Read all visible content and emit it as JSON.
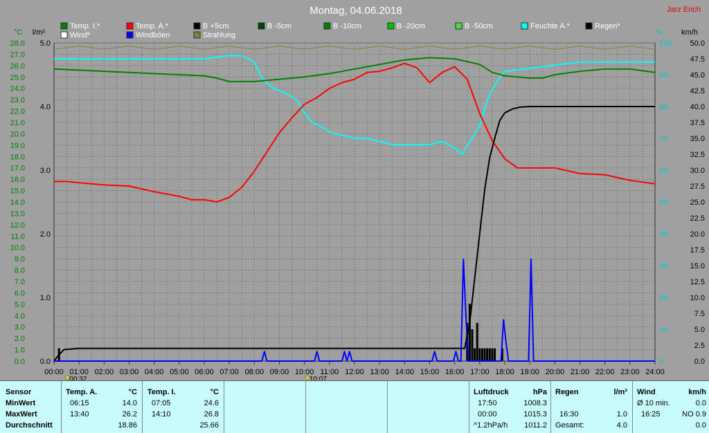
{
  "header": {
    "date": "Montag, 04.06.2018",
    "author": "Jarz Erich"
  },
  "colors": {
    "background": "#a0a0a0",
    "plot_background": "#a0a0a0",
    "grid": "#7c7c7c",
    "left_axis": "#008000",
    "right_axis": "#00c8c8",
    "temp_inside": "#008000",
    "temp_outside": "#ff0000",
    "humidity": "#00ffff",
    "rain": "#000000",
    "wind_gusts": "#0000ff",
    "radiation": "#808040",
    "panel": "#c8fcfc"
  },
  "chart_data": {
    "type": "line",
    "x_range": [
      "00:00",
      "24:00"
    ],
    "x_ticks": [
      "00:00",
      "01:00",
      "02:00",
      "03:00",
      "04:00",
      "05:00",
      "06:00",
      "07:00",
      "08:00",
      "09:00",
      "10:00",
      "11:00",
      "12:00",
      "13:00",
      "14:00",
      "15:00",
      "16:00",
      "17:00",
      "18:00",
      "19:00",
      "20:00",
      "21:00",
      "22:00",
      "23:00",
      "24:00"
    ],
    "axes": {
      "temp": {
        "label": "°C",
        "ylim": [
          0,
          28
        ],
        "step": 1
      },
      "rain": {
        "label": "l/m²",
        "ylim": [
          0,
          5
        ],
        "ticks": [
          0.0,
          1.0,
          2.0,
          3.0,
          4.0,
          5.0
        ]
      },
      "humidity": {
        "label": "%",
        "ylim": [
          0,
          100
        ],
        "step": 10
      },
      "wind": {
        "label": "km/h",
        "ylim": [
          0,
          50
        ],
        "step": 2.5
      }
    },
    "grid": true,
    "legend": [
      {
        "name": "Temp. I.*",
        "color": "#008000"
      },
      {
        "name": "Temp. A.*",
        "color": "#ff0000"
      },
      {
        "name": "B +5cm",
        "color": "#000000"
      },
      {
        "name": "B -5cm",
        "color": "#004000"
      },
      {
        "name": "B -10cm",
        "color": "#008000"
      },
      {
        "name": "B -20cm",
        "color": "#00c000"
      },
      {
        "name": "B -50cm",
        "color": "#40e040"
      },
      {
        "name": "Feuchte A.*",
        "color": "#00ffff"
      },
      {
        "name": "Regen*",
        "color": "#000000"
      },
      {
        "name": "Wind*",
        "color": "#ffffff"
      },
      {
        "name": "Windböen",
        "color": "#0000ff"
      },
      {
        "name": "Strahlung",
        "color": "#808040"
      }
    ],
    "series": [
      {
        "name": "Temp. I.*",
        "axis": "temp",
        "color": "#008000",
        "x": [
          0,
          1,
          2,
          3,
          4,
          5,
          6,
          6.5,
          7,
          7.5,
          8,
          9,
          10,
          11,
          12,
          13,
          14,
          15,
          16,
          17,
          17.5,
          18,
          19,
          19.5,
          20,
          21,
          22,
          23,
          24
        ],
        "y": [
          25.7,
          25.6,
          25.5,
          25.4,
          25.3,
          25.2,
          25.1,
          24.9,
          24.6,
          24.6,
          24.6,
          24.8,
          25.0,
          25.3,
          25.7,
          26.1,
          26.5,
          26.7,
          26.6,
          26.1,
          25.4,
          25.1,
          24.9,
          24.9,
          25.2,
          25.5,
          25.7,
          25.7,
          25.4
        ]
      },
      {
        "name": "Temp. A.*",
        "axis": "temp",
        "color": "#ff0000",
        "x": [
          0,
          0.5,
          1,
          2,
          3,
          4,
          5,
          5.5,
          6,
          6.5,
          7,
          7.5,
          8,
          8.5,
          9,
          9.5,
          10,
          10.5,
          11,
          11.5,
          12,
          12.5,
          13,
          13.5,
          14,
          14.5,
          15,
          15.5,
          16,
          16.5,
          17,
          17.5,
          18,
          18.5,
          19,
          20,
          21,
          22,
          23,
          24
        ],
        "y": [
          15.8,
          15.8,
          15.7,
          15.5,
          15.4,
          14.9,
          14.5,
          14.2,
          14.2,
          14.0,
          14.4,
          15.3,
          16.7,
          18.4,
          20.1,
          21.4,
          22.6,
          23.2,
          24.0,
          24.5,
          24.8,
          25.4,
          25.5,
          25.8,
          26.2,
          25.8,
          24.5,
          25.4,
          25.9,
          24.8,
          21.8,
          19.4,
          17.8,
          17.0,
          17.0,
          17.0,
          16.5,
          16.4,
          15.9,
          15.6
        ]
      },
      {
        "name": "Feuchte A.*",
        "axis": "humidity",
        "color": "#00ffff",
        "x": [
          0,
          1,
          2,
          3,
          4,
          5,
          6,
          7,
          7.5,
          8,
          8.3,
          8.7,
          9.3,
          9.7,
          10,
          10.3,
          10.6,
          11,
          11.5,
          12,
          12.5,
          13,
          13.5,
          14,
          14.5,
          15,
          15.5,
          16,
          16.3,
          16.6,
          17,
          17.3,
          17.7,
          18,
          19,
          20,
          21,
          22,
          23,
          24
        ],
        "y": [
          95,
          95,
          95,
          95,
          95,
          95,
          95,
          96,
          96,
          94,
          89,
          86,
          84,
          82,
          78,
          75,
          74,
          72,
          71,
          70,
          70,
          69,
          68,
          68,
          68,
          68,
          69,
          67,
          65,
          69,
          74,
          82,
          88,
          91,
          92,
          93,
          94,
          94,
          94,
          94
        ]
      },
      {
        "name": "Regen*",
        "axis": "rain",
        "color": "#000000",
        "x": [
          0,
          0.2,
          0.4,
          1,
          2,
          5,
          10,
          15,
          16.4,
          16.6,
          16.8,
          17.0,
          17.2,
          17.4,
          17.6,
          17.8,
          18.0,
          18.3,
          18.6,
          19,
          20,
          22,
          24
        ],
        "y": [
          0.0,
          0.1,
          0.18,
          0.2,
          0.2,
          0.2,
          0.2,
          0.2,
          0.2,
          0.6,
          1.3,
          2.0,
          2.7,
          3.2,
          3.5,
          3.78,
          3.9,
          3.96,
          3.99,
          4.0,
          4.0,
          4.0,
          4.0
        ]
      },
      {
        "name": "Windböen",
        "axis": "wind",
        "color": "#0000ff",
        "x": [
          0,
          8.3,
          8.4,
          8.5,
          10.4,
          10.5,
          10.6,
          11.5,
          11.6,
          11.7,
          11.8,
          11.9,
          12.0,
          15.1,
          15.2,
          15.3,
          15.95,
          16.05,
          16.15,
          16.25,
          16.35,
          16.45,
          16.55,
          17.85,
          17.95,
          18.05,
          18.15,
          18.3,
          18.95,
          19.05,
          19.15,
          19.3,
          24
        ],
        "y": [
          0,
          0,
          1.5,
          0,
          0,
          1.5,
          0,
          0,
          1.5,
          0,
          1.5,
          0,
          0,
          0,
          1.5,
          0,
          0,
          1.5,
          0,
          0,
          16,
          7,
          0,
          0,
          6.5,
          3,
          0,
          0,
          0,
          16,
          0,
          0,
          0
        ]
      },
      {
        "name": "Strahlung",
        "axis": "humidity",
        "color": "#808040",
        "x": [
          0,
          1,
          2,
          3,
          4,
          5,
          6,
          7,
          8,
          9,
          10,
          11,
          12,
          13,
          14,
          15,
          16,
          17,
          18,
          19,
          20,
          21,
          22,
          23,
          24
        ],
        "y": [
          98,
          99,
          98,
          99,
          98,
          99,
          98,
          99,
          98,
          99,
          98,
          99,
          98,
          99,
          98,
          99,
          98,
          99,
          98,
          99,
          98,
          99,
          98,
          99,
          98
        ]
      },
      {
        "name": "Regen (Intensität)",
        "axis": "rain",
        "type": "bar",
        "color": "#000000",
        "x": [
          0.2,
          16.5,
          16.6,
          16.7,
          16.8,
          16.9,
          17.0,
          17.1,
          17.2,
          17.3,
          17.4,
          17.5,
          17.6,
          17.9
        ],
        "y": [
          0.2,
          0.6,
          0.9,
          0.5,
          0.2,
          0.6,
          0.2,
          0.2,
          0.2,
          0.2,
          0.2,
          0.2,
          0.2,
          0.2
        ]
      }
    ],
    "markers": [
      {
        "time": "00:32",
        "color": "#ffff00"
      },
      {
        "time": "10:07",
        "color": "#ffff00"
      }
    ]
  },
  "stats": {
    "sensor_header": "Sensor",
    "row_labels": [
      "MinWert",
      "MaxWert",
      "Durchschnitt"
    ],
    "temp_a": {
      "title": "Temp. A.",
      "unit": "°C",
      "min_time": "06:15",
      "min": "14.0",
      "max_time": "13:40",
      "max": "26.2",
      "avg": "18.86"
    },
    "temp_i": {
      "title": "Temp. I.",
      "unit": "°C",
      "min_time": "07:05",
      "min": "24.6",
      "max_time": "14:10",
      "max": "26.8",
      "avg": "25.66"
    },
    "pressure": {
      "title": "Luftdruck",
      "unit": "hPa",
      "min_time": "17:50",
      "min": "1008.3",
      "max_time": "00:00",
      "max": "1015.3",
      "trend": "^1.2hPa/h",
      "avg": "1011.2"
    },
    "rain": {
      "title": "Regen",
      "unit": "l/m²",
      "max_time": "16:30",
      "max": "1.0",
      "total_label": "Gesamt:",
      "total": "4.0"
    },
    "wind": {
      "title": "Wind",
      "unit": "km/h",
      "avg_label": "Ø 10 min.",
      "avg": "0.0",
      "max_time": "16:25",
      "max": "NO 0.9",
      "value3": "0.0"
    }
  }
}
